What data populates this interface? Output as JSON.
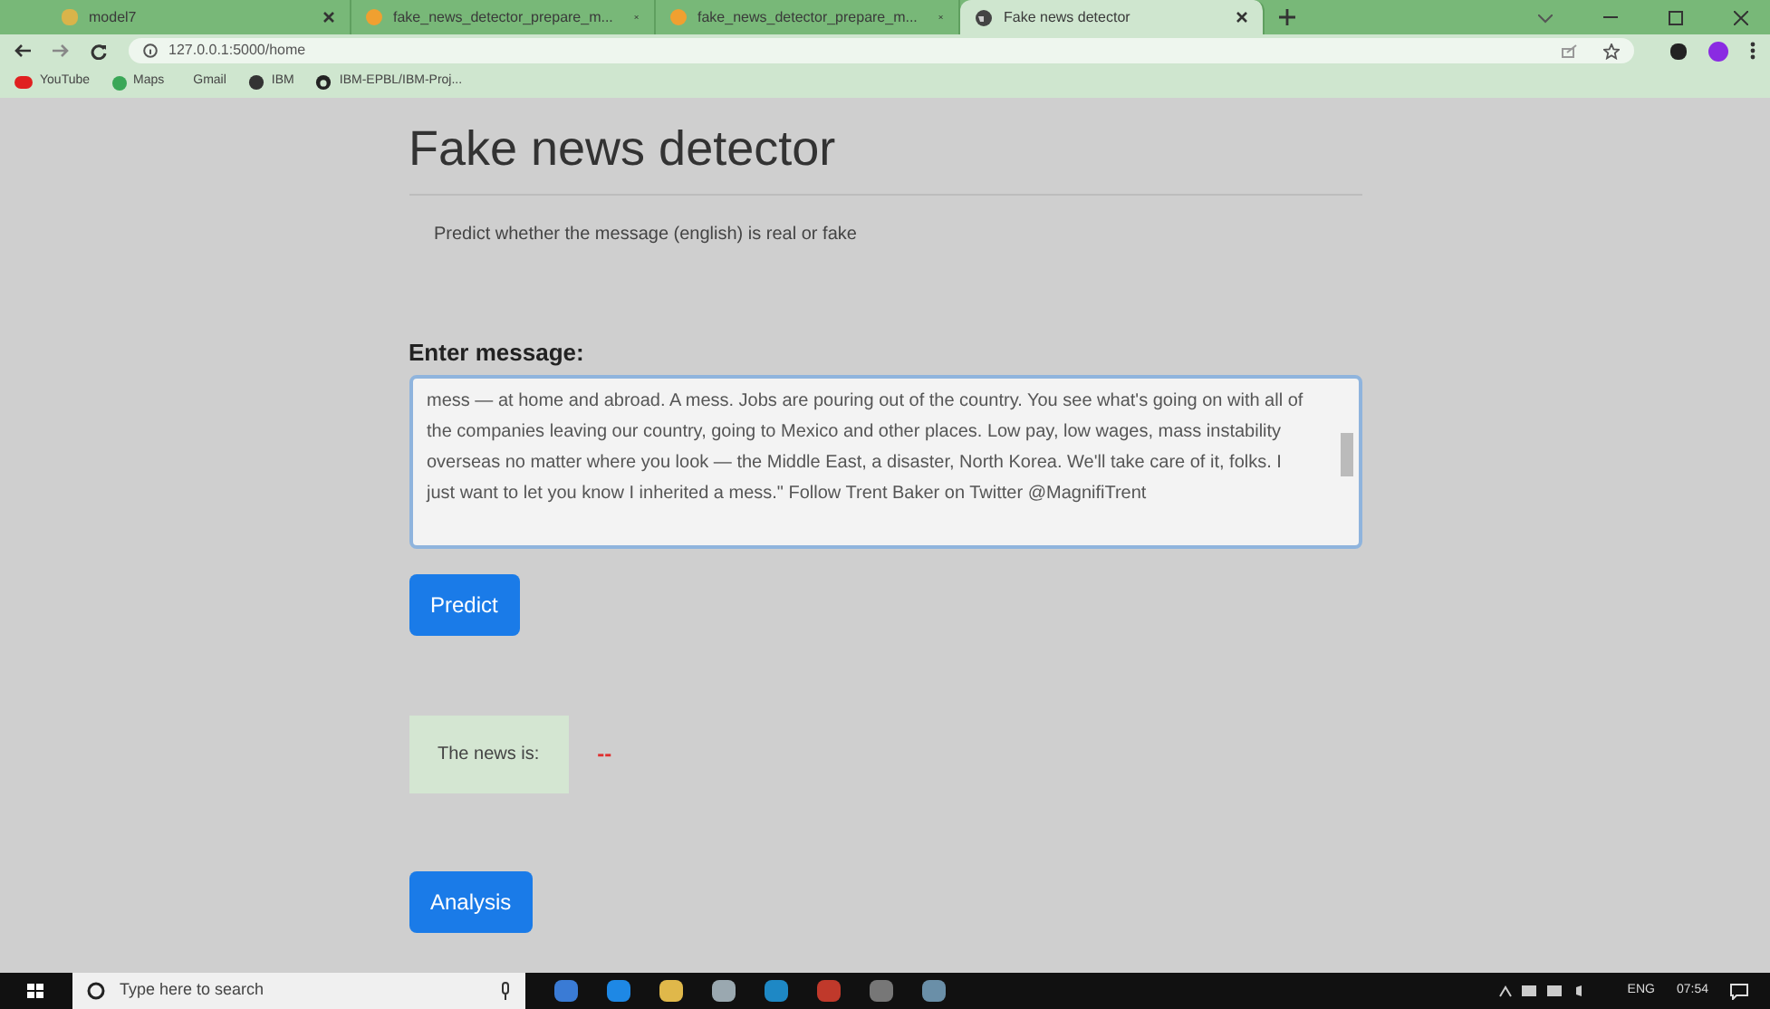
{
  "browser": {
    "tabs": [
      {
        "title": "model7",
        "selected": false,
        "kind": "doc"
      },
      {
        "title": "fake_news_detector_prepare_m...",
        "selected": false,
        "kind": "jupyter"
      },
      {
        "title": "fake_news_detector_prepare_m...",
        "selected": false,
        "kind": "jupyter"
      },
      {
        "title": "Fake news detector",
        "selected": true,
        "kind": "globe"
      }
    ],
    "address": "127.0.0.1:5000/home",
    "bookmarks": [
      {
        "label": "YouTube",
        "kind": "youtube"
      },
      {
        "label": "Maps",
        "kind": "maps"
      },
      {
        "label": "Gmail",
        "kind": "gmail"
      },
      {
        "label": "IBM",
        "kind": "globe"
      },
      {
        "label": "IBM-EPBL/IBM-Proj...",
        "kind": "github"
      }
    ]
  },
  "page": {
    "title": "Fake news detector",
    "subtitle": "Predict whether the message (english) is real or fake",
    "message_label": "Enter message:",
    "message": "mess — at home and abroad. A mess. Jobs are pouring out of the country. You see what's going on with all of the companies leaving our country, going to Mexico and other places. Low pay, low wages, mass instability overseas no matter where you look — the Middle East, a disaster, North Korea. We'll take care of it, folks. I just want to let you know I inherited a mess.\" Follow Trent Baker on Twitter @MagnifiTrent",
    "predict_button": "Predict",
    "result_label": "The news is:",
    "result_value": "--",
    "analysis_button": "Analysis"
  },
  "taskbar": {
    "search_placeholder": "Type here to search",
    "language": "ENG",
    "time": "07:54"
  }
}
